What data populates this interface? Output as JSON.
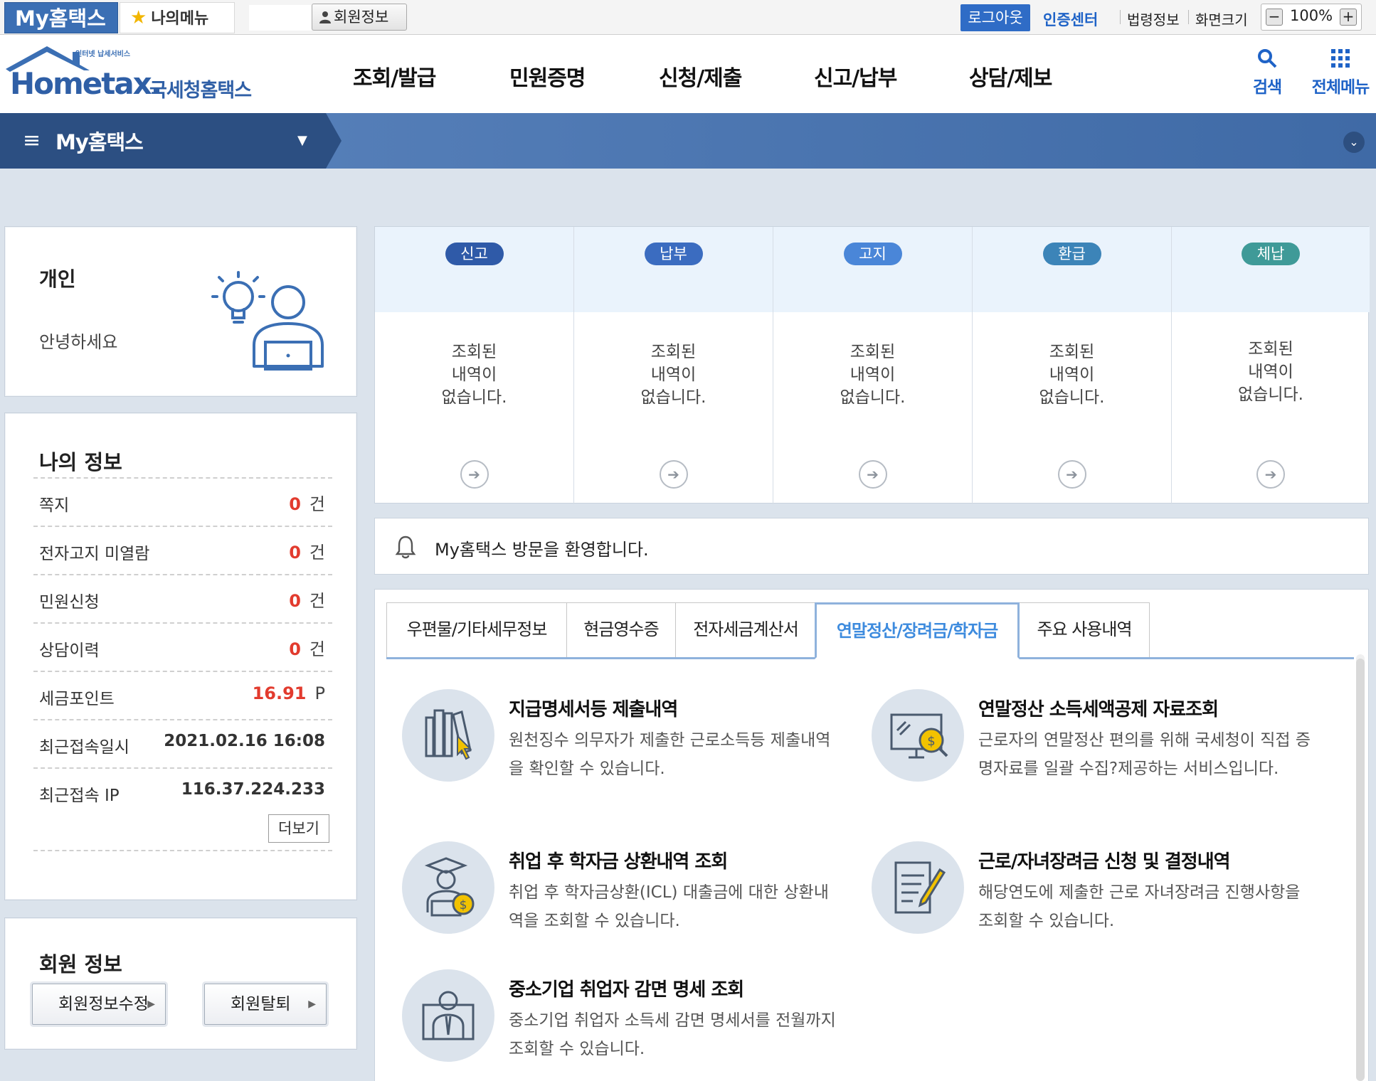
{
  "topbar": {
    "brand": "My홈택스",
    "my_menu": "나의메뉴",
    "member_info": "회원정보",
    "logout": "로그아웃",
    "cert_center": "인증센터",
    "law_info": "법령정보",
    "screen_size": "화면크기",
    "zoom": "100%",
    "zoom_out": "−",
    "zoom_in": "+"
  },
  "header": {
    "logo_small": "인터넷 납세서비스",
    "logo_main": "Hometax.",
    "logo_kor": "국세청홈택스",
    "menu": [
      "조회/발급",
      "민원증명",
      "신청/제출",
      "신고/납부",
      "상담/제보"
    ],
    "search": "검색",
    "all_menu": "전체메뉴"
  },
  "nav": {
    "title": "My홈택스"
  },
  "personal": {
    "title": "개인",
    "greeting": "안녕하세요"
  },
  "my_info": {
    "title": "나의 정보",
    "rows": [
      {
        "label": "쪽지",
        "value": "0",
        "unit": "건"
      },
      {
        "label": "전자고지 미열람",
        "value": "0",
        "unit": "건"
      },
      {
        "label": "민원신청",
        "value": "0",
        "unit": "건"
      },
      {
        "label": "상담이력",
        "value": "0",
        "unit": "건"
      },
      {
        "label": "세금포인트",
        "value": "16.91",
        "unit": "P"
      },
      {
        "label": "최근접속일시",
        "value": "2021.02.16 16:08"
      },
      {
        "label": "최근접속 IP",
        "value": "116.37.224.233"
      }
    ],
    "more": "더보기"
  },
  "member": {
    "title": "회원 정보",
    "edit": "회원정보수정",
    "withdraw": "회원탈퇴"
  },
  "tiles": [
    {
      "badge": "신고",
      "color": "#2f5aa8",
      "msg": [
        "조회된",
        "내역이",
        "없습니다."
      ]
    },
    {
      "badge": "납부",
      "color": "#3b6cc0",
      "msg": [
        "조회된",
        "내역이",
        "없습니다."
      ]
    },
    {
      "badge": "고지",
      "color": "#4a86d8",
      "msg": [
        "조회된",
        "내역이",
        "없습니다."
      ]
    },
    {
      "badge": "환급",
      "color": "#3c84b8",
      "msg": [
        "조회된",
        "내역이",
        "없습니다."
      ]
    },
    {
      "badge": "체납",
      "color": "#3f9a98",
      "msg": [
        "조회된",
        "내역이",
        "없습니다."
      ]
    }
  ],
  "notice": {
    "text": "My홈택스 방문을 환영합니다."
  },
  "tabs": [
    {
      "label": "우편물/기타세무정보",
      "active": false
    },
    {
      "label": "현금영수증",
      "active": false
    },
    {
      "label": "전자세금계산서",
      "active": false
    },
    {
      "label": "연말정산/장려금/학자금",
      "active": true
    },
    {
      "label": "주요 사용내역",
      "active": false
    }
  ],
  "services": [
    {
      "icon": "books-icon",
      "title": "지급명세서등 제출내역",
      "desc": "원천징수 의무자가 제출한 근로소득등 제출내역을 확인할 수 있습니다."
    },
    {
      "icon": "monitor-dollar-icon",
      "title": "연말정산 소득세액공제 자료조회",
      "desc": "근로자의 연말정산 편의를 위해 국세청이 직접 증명자료를 일괄 수집?제공하는 서비스입니다."
    },
    {
      "icon": "graduate-icon",
      "title": "취업 후 학자금 상환내역 조회",
      "desc": "취업 후 학자금상환(ICL) 대출금에 대한 상환내역을 조회할 수 있습니다."
    },
    {
      "icon": "document-pen-icon",
      "title": "근로/자녀장려금 신청 및 결정내역",
      "desc": "해당연도에 제출한 근로 자녀장려금 진행사항을 조회할 수 있습니다."
    },
    {
      "icon": "employee-icon",
      "title": "중소기업 취업자 감면 명세 조회",
      "desc": "중소기업 취업자 소득세 감면 명세서를 전월까지 조회할 수 있습니다."
    }
  ]
}
